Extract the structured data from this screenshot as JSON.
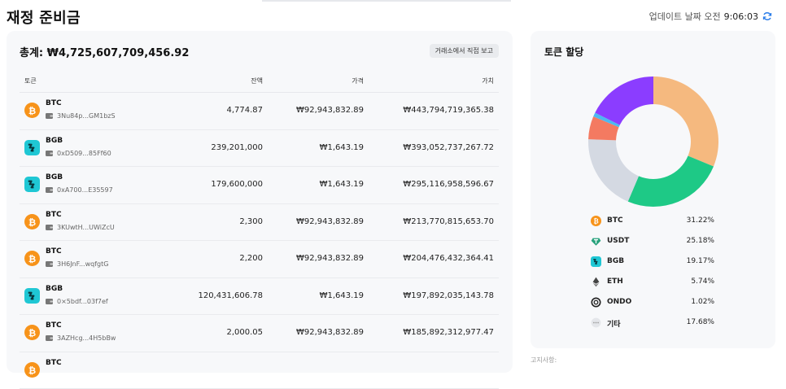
{
  "header": {
    "title": "재정 준비금",
    "updated_label": "업데이트 날짜 오전",
    "updated_time": "9:06:03",
    "refresh_icon": "refresh-icon"
  },
  "reserves": {
    "total_label": "총계:",
    "total_value": "₩4,725,607,709,456.92",
    "report_button": "거래소에서 직접 보고",
    "columns": {
      "token": "토큰",
      "balance": "잔액",
      "price": "가격",
      "value": "가치"
    },
    "rows": [
      {
        "symbol": "BTC",
        "icon": "btc-icon",
        "address": "3Nu84p...GM1bzS",
        "balance": "4,774.87",
        "price": "₩92,943,832.89",
        "value": "₩443,794,719,365.38"
      },
      {
        "symbol": "BGB",
        "icon": "bgb-icon",
        "address": "0xD509...85Ff60",
        "balance": "239,201,000",
        "price": "₩1,643.19",
        "value": "₩393,052,737,267.72"
      },
      {
        "symbol": "BGB",
        "icon": "bgb-icon",
        "address": "0xA700...E35597",
        "balance": "179,600,000",
        "price": "₩1,643.19",
        "value": "₩295,116,958,596.67"
      },
      {
        "symbol": "BTC",
        "icon": "btc-icon",
        "address": "3KUwtH...UWiZcU",
        "balance": "2,300",
        "price": "₩92,943,832.89",
        "value": "₩213,770,815,653.70"
      },
      {
        "symbol": "BTC",
        "icon": "btc-icon",
        "address": "3H6JnF...wqfgtG",
        "balance": "2,200",
        "price": "₩92,943,832.89",
        "value": "₩204,476,432,364.41"
      },
      {
        "symbol": "BGB",
        "icon": "bgb-icon",
        "address": "0×5bdf...03f7ef",
        "balance": "120,431,606.78",
        "price": "₩1,643.19",
        "value": "₩197,892,035,143.78"
      },
      {
        "symbol": "BTC",
        "icon": "btc-icon",
        "address": "3AZHcg...4H5bBw",
        "balance": "2,000.05",
        "price": "₩92,943,832.89",
        "value": "₩185,892,312,977.47"
      },
      {
        "symbol": "BTC",
        "icon": "btc-icon",
        "address": "",
        "balance": "",
        "price": "",
        "value": ""
      }
    ]
  },
  "allocation": {
    "title": "토큰 할당",
    "items": [
      {
        "name": "BTC",
        "icon": "btc-icon",
        "percent": "31.22%",
        "share": 31.22,
        "color": "#f5b97f"
      },
      {
        "name": "USDT",
        "icon": "usdt-icon",
        "percent": "25.18%",
        "share": 25.18,
        "color": "#1ec986"
      },
      {
        "name": "BGB",
        "icon": "bgb-icon",
        "percent": "19.17%",
        "share": 19.17,
        "color": "#d4d9e2"
      },
      {
        "name": "ETH",
        "icon": "eth-icon",
        "percent": "5.74%",
        "share": 5.74,
        "color": "#f47a61"
      },
      {
        "name": "ONDO",
        "icon": "ondo-icon",
        "percent": "1.02%",
        "share": 1.02,
        "color": "#4db8f0"
      },
      {
        "name": "기타",
        "icon": "other-icon",
        "percent": "17.68%",
        "share": 17.68,
        "color": "#8b3dff"
      }
    ]
  },
  "colors": {
    "btc": "#f7931a",
    "bgb": "#1fc7d4",
    "usdt": "#26a17b"
  },
  "footer_hint": "고지사항:"
}
